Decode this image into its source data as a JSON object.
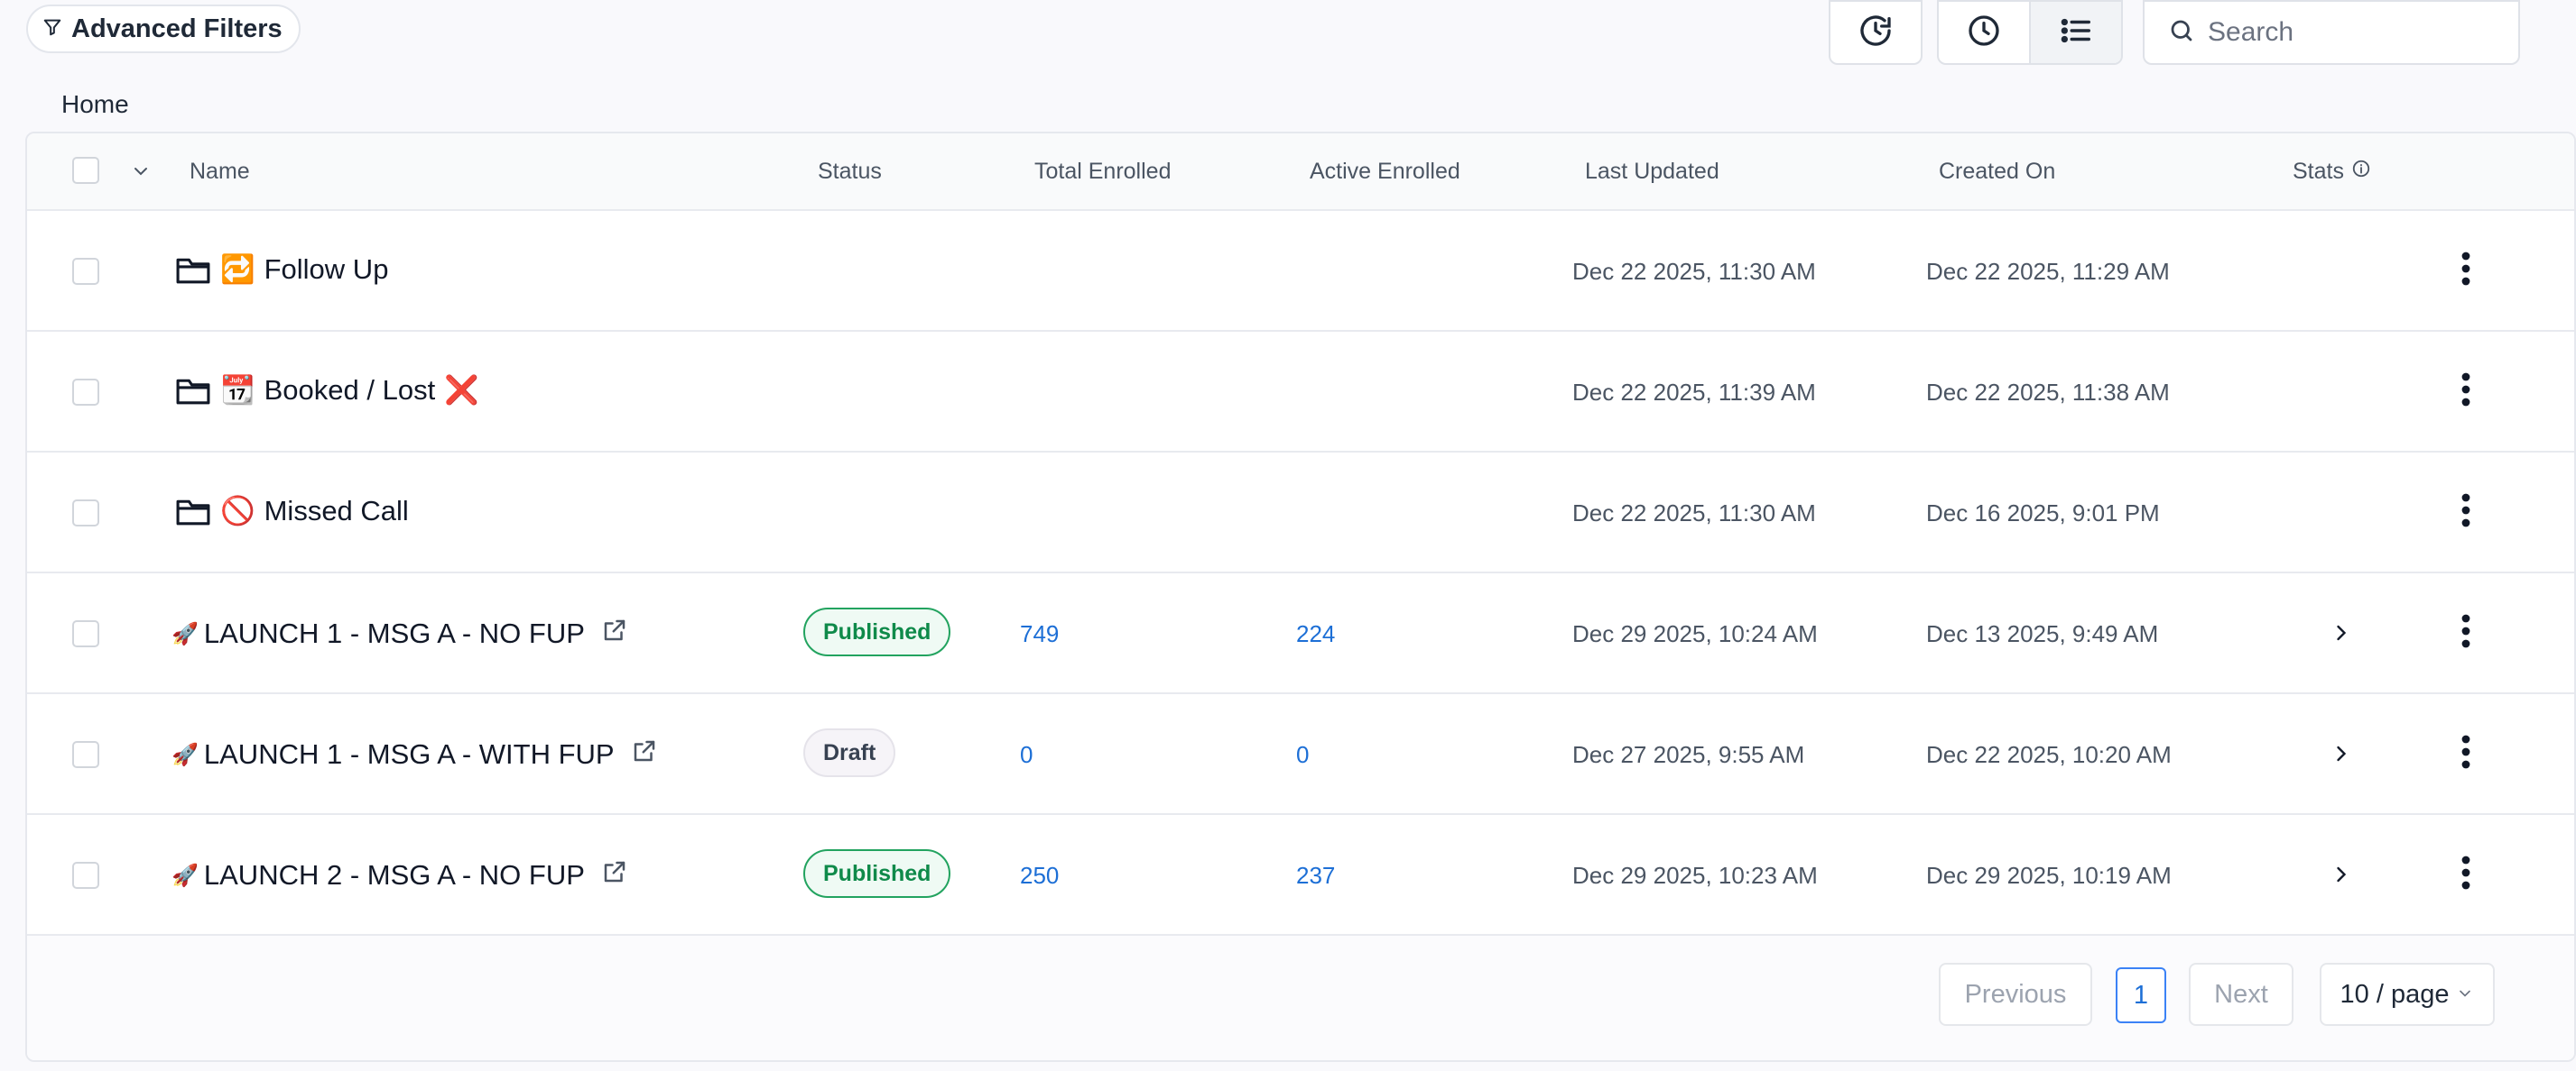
{
  "toolbar": {
    "advanced_filters_label": "Advanced Filters",
    "search_placeholder": "Search"
  },
  "breadcrumb": {
    "home": "Home"
  },
  "table": {
    "columns": {
      "name": "Name",
      "status": "Status",
      "total_enrolled": "Total Enrolled",
      "active_enrolled": "Active Enrolled",
      "last_updated": "Last Updated",
      "created_on": "Created On",
      "stats": "Stats"
    },
    "rows": [
      {
        "type": "folder",
        "emoji": "🔁",
        "name": "Follow Up",
        "suffix": "",
        "status": "",
        "total": "",
        "active": "",
        "last_updated": "Dec 22 2025, 11:30 AM",
        "created_on": "Dec 22 2025, 11:29 AM"
      },
      {
        "type": "folder",
        "emoji": "📆",
        "name": "Booked / Lost",
        "suffix": "❌",
        "status": "",
        "total": "",
        "active": "",
        "last_updated": "Dec 22 2025, 11:39 AM",
        "created_on": "Dec 22 2025, 11:38 AM"
      },
      {
        "type": "folder",
        "emoji": "🚫",
        "name": "Missed Call",
        "suffix": "",
        "status": "",
        "total": "",
        "active": "",
        "last_updated": "Dec 22 2025, 11:30 AM",
        "created_on": "Dec 16 2025, 9:01 PM"
      },
      {
        "type": "workflow",
        "emoji": "🚀",
        "name": "LAUNCH 1 - MSG A - NO FUP",
        "suffix": "",
        "status": "Published",
        "total": "749",
        "active": "224",
        "last_updated": "Dec 29 2025, 10:24 AM",
        "created_on": "Dec 13 2025, 9:49 AM"
      },
      {
        "type": "workflow",
        "emoji": "🚀",
        "name": "LAUNCH 1 - MSG A - WITH FUP",
        "suffix": "",
        "status": "Draft",
        "total": "0",
        "active": "0",
        "last_updated": "Dec 27 2025, 9:55 AM",
        "created_on": "Dec 22 2025, 10:20 AM"
      },
      {
        "type": "workflow",
        "emoji": "🚀",
        "name": "LAUNCH 2 - MSG A - NO FUP",
        "suffix": "",
        "status": "Published",
        "total": "250",
        "active": "237",
        "last_updated": "Dec 29 2025, 10:23 AM",
        "created_on": "Dec 29 2025, 10:19 AM"
      }
    ]
  },
  "pagination": {
    "previous": "Previous",
    "current_page": "1",
    "next": "Next",
    "page_size": "10 / page"
  },
  "colors": {
    "accent_blue": "#1d6fd6",
    "published_green": "#0f8a4a",
    "background": "#f9f9fc"
  }
}
